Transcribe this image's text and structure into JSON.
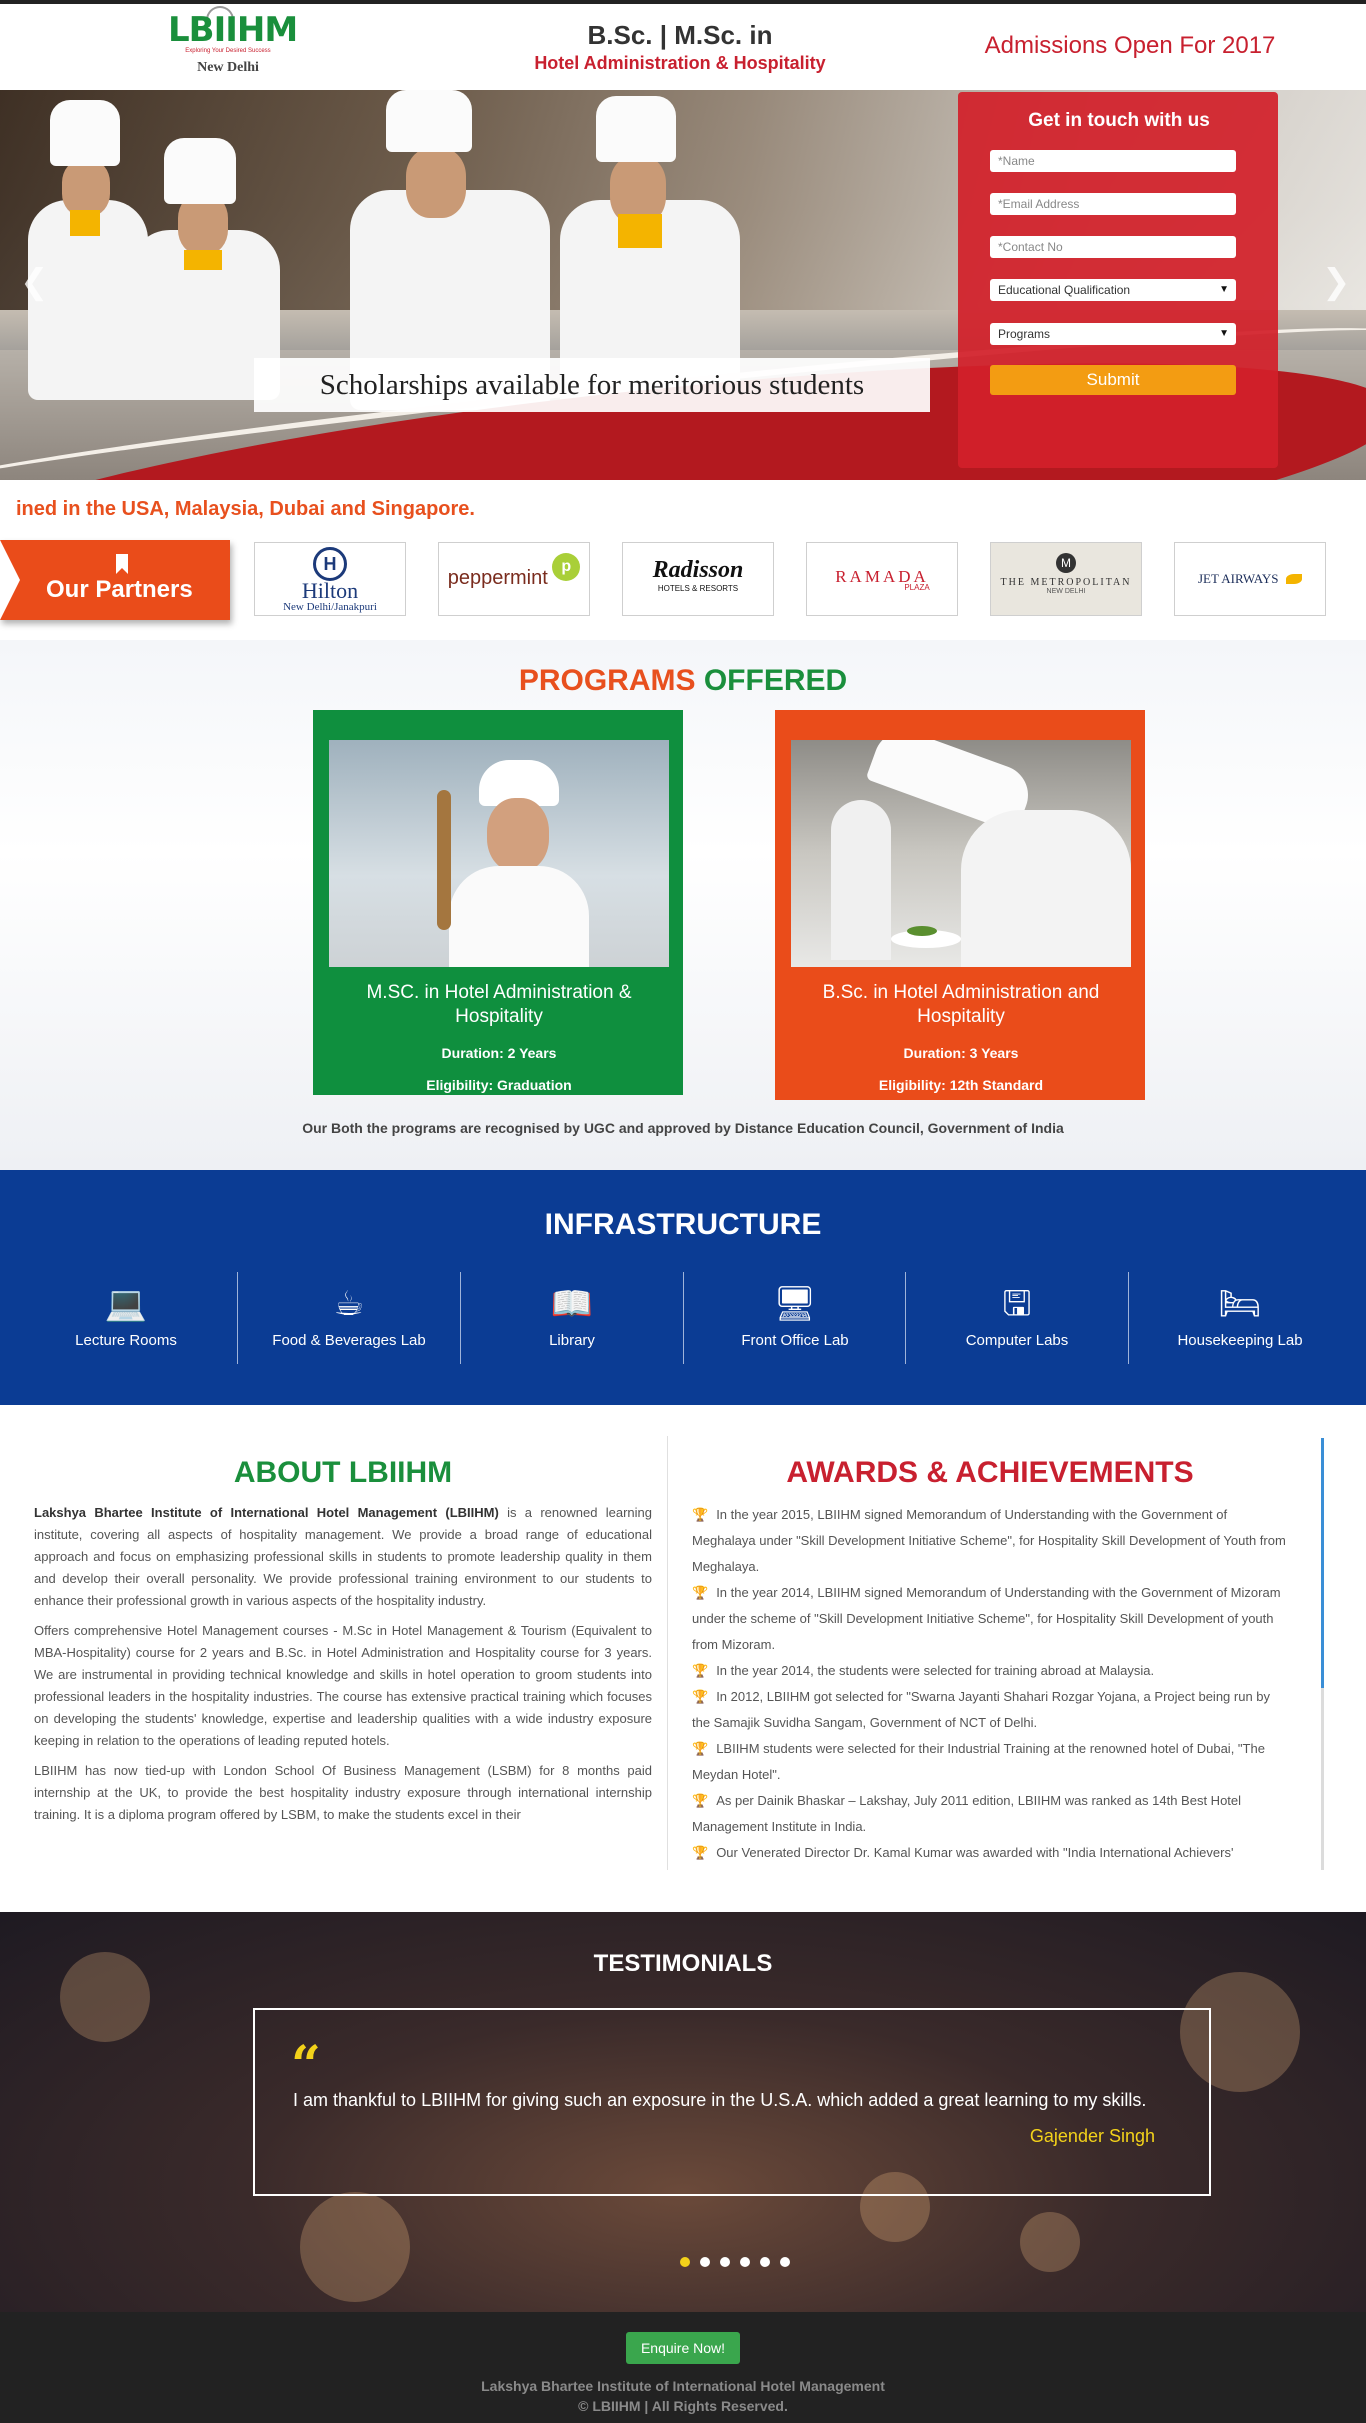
{
  "header": {
    "logo_text": "LBIIHM",
    "logo_tagline": "Exploring Your Desired Success",
    "logo_city": "New Delhi",
    "course_line1": "B.Sc. | M.Sc. in",
    "course_line2": "Hotel Administration & Hospitality",
    "admissions": "Admissions Open For 2017"
  },
  "hero": {
    "banner_text": "Scholarships available for meritorious students",
    "prev_icon": "chevron-left-icon",
    "next_icon": "chevron-right-icon"
  },
  "form": {
    "title": "Get in touch with us",
    "name_placeholder": "*Name",
    "email_placeholder": "*Email Address",
    "contact_placeholder": "*Contact No",
    "qualification_select": "Educational Qualification",
    "programs_select": "Programs",
    "submit_label": "Submit"
  },
  "ticker_text": "ined in the USA, Malaysia, Dubai and Singapore.",
  "partners": {
    "label": "Our Partners",
    "items": [
      {
        "name": "Hilton",
        "sub": "New Delhi/Janakpuri"
      },
      {
        "name": "peppermint"
      },
      {
        "name": "Radisson",
        "sub": "HOTELS & RESORTS"
      },
      {
        "name": "RAMADA",
        "sub": "PLAZA"
      },
      {
        "name": "THE METROPOLITAN",
        "sub": "NEW DELHI"
      },
      {
        "name": "JET AIRWAYS"
      }
    ]
  },
  "programs": {
    "title_a": "PROGRAMS",
    "title_b": "OFFERED",
    "cards": [
      {
        "title": "M.SC. in Hotel Administration & Hospitality",
        "duration": "Duration: 2 Years",
        "eligibility": "Eligibility: Graduation"
      },
      {
        "title": "B.Sc. in Hotel Administration and Hospitality",
        "duration": "Duration: 3 Years",
        "eligibility": "Eligibility: 12th Standard"
      }
    ],
    "note": "Our Both the programs are recognised by UGC and approved by Distance Education Council, Government of India"
  },
  "infrastructure": {
    "title": "INFRASTRUCTURE",
    "items": [
      {
        "label": "Lecture Rooms",
        "icon": "laptop-icon"
      },
      {
        "label": "Food & Beverages Lab",
        "icon": "coffee-cup-icon"
      },
      {
        "label": "Library",
        "icon": "book-icon"
      },
      {
        "label": "Front Office Lab",
        "icon": "desktop-icon"
      },
      {
        "label": "Computer Labs",
        "icon": "monitor-icon"
      },
      {
        "label": "Housekeeping Lab",
        "icon": "bed-icon"
      }
    ]
  },
  "about": {
    "title": "ABOUT LBIIHM",
    "p1_bold": "Lakshya Bhartee Institute of International Hotel Management (LBIIHM)",
    "p1_rest": " is a renowned learning institute, covering all aspects of hospitality management. We provide a broad range of educational approach and focus on emphasizing professional skills in students to promote leadership quality in them and develop their overall personality. We provide professional training environment to our students to enhance their professional growth in various aspects of the hospitality industry.",
    "p2": "Offers comprehensive Hotel Management courses - M.Sc in Hotel Management & Tourism (Equivalent to MBA-Hospitality) course for 2 years and B.Sc. in Hotel Administration and Hospitality course for 3 years. We are instrumental in providing technical knowledge and skills in hotel operation to groom students into professional leaders in the hospitality industries. The course has extensive practical training which focuses on developing the students' knowledge, expertise and leadership qualities with a wide industry exposure keeping in relation to the operations of leading reputed hotels.",
    "p3": "LBIIHM has now tied-up with London School Of Business Management (LSBM) for 8 months paid internship at the UK, to provide the best hospitality industry exposure through international internship training. It is a diploma program offered by LSBM, to make the students excel in their"
  },
  "awards": {
    "title": "AWARDS & ACHIEVEMENTS",
    "items": [
      "In the year 2015, LBIIHM signed Memorandum of Understanding with the Government of Meghalaya under \"Skill Development Initiative Scheme\", for Hospitality Skill Development of Youth from Meghalaya.",
      "In the year 2014, LBIIHM signed Memorandum of Understanding with the Government of Mizoram under the scheme of \"Skill Development Initiative Scheme\", for Hospitality Skill Development of youth from Mizoram.",
      "In the year 2014, the students were selected for training abroad at Malaysia.",
      "In 2012, LBIIHM got selected for \"Swarna Jayanti Shahari Rozgar Yojana, a Project being run by the Samajik Suvidha Sangam, Government of NCT of Delhi.",
      "LBIIHM students were selected for their Industrial Training at the renowned hotel of Dubai, \"The Meydan Hotel\".",
      "As per Dainik Bhaskar – Lakshay, July 2011 edition, LBIIHM was ranked as 14th Best Hotel Management Institute in India.",
      "Our Venerated Director Dr. Kamal Kumar was awarded with \"India International Achievers'"
    ]
  },
  "testimonials": {
    "title": "TESTIMONIALS",
    "quote": "I am thankful to LBIIHM for giving such an exposure in the U.S.A. which added a great learning to my skills.",
    "author": "Gajender Singh",
    "dots": 6,
    "active_dot": 0
  },
  "footer": {
    "enquire_label": "Enquire Now!",
    "line1": "Lakshya Bhartee Institute of International Hotel Management",
    "line2": "© LBIIHM | All Rights Reserved."
  },
  "colors": {
    "brand_green": "#1a8f3c",
    "brand_red": "#c8202f",
    "brand_orange": "#ea4c1a",
    "infra_blue": "#0b3c94",
    "submit_orange": "#f39c12",
    "testimonial_yellow": "#f3d21a"
  }
}
